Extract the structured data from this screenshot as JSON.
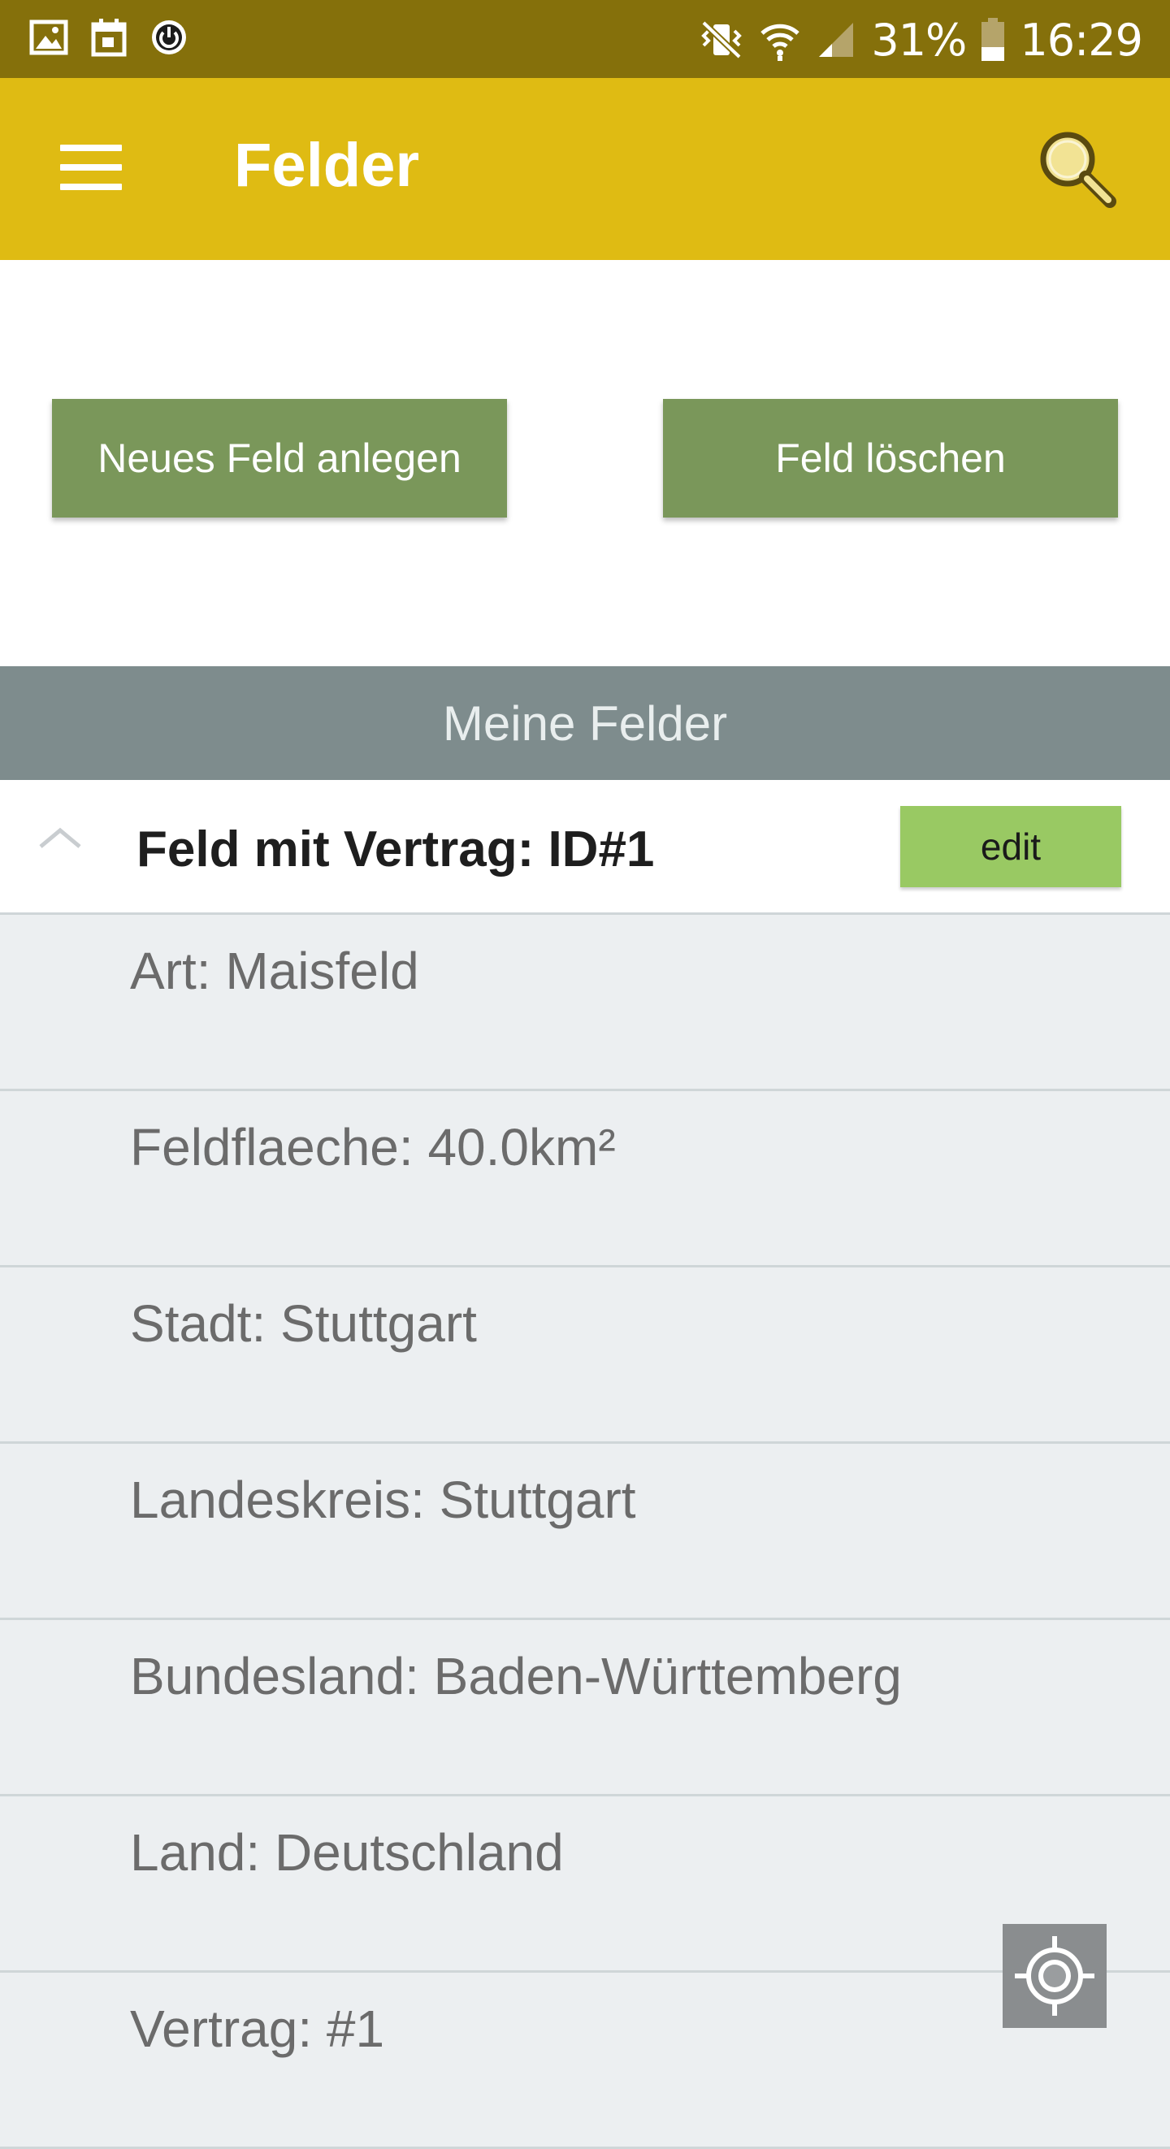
{
  "status_bar": {
    "battery": "31%",
    "time": "16:29",
    "left_icons": [
      "image-icon",
      "calendar-icon",
      "power-icon"
    ],
    "right_icons": [
      "vibrate-mute-icon",
      "wifi-icon",
      "signal-icon",
      "battery-icon"
    ]
  },
  "app_bar": {
    "title": "Felder",
    "menu_icon": "menu-icon",
    "search_icon": "search-icon",
    "color": "#dfbb13"
  },
  "actions": {
    "new_label": "Neues Feld anlegen",
    "delete_label": "Feld löschen",
    "color": "#7a975a"
  },
  "section": {
    "title": "Meine Felder"
  },
  "field_group": {
    "title": "Feld mit Vertrag: ID#1",
    "edit_label": "edit",
    "expanded": true,
    "details": [
      "Art: Maisfeld",
      "Feldflaeche: 40.0km²",
      "Stadt: Stuttgart",
      "Landeskreis: Stuttgart",
      "Bundesland: Baden-Württemberg",
      "Land: Deutschland",
      "Vertrag: #1"
    ]
  },
  "fab": {
    "icon": "crosshair-location-icon"
  }
}
